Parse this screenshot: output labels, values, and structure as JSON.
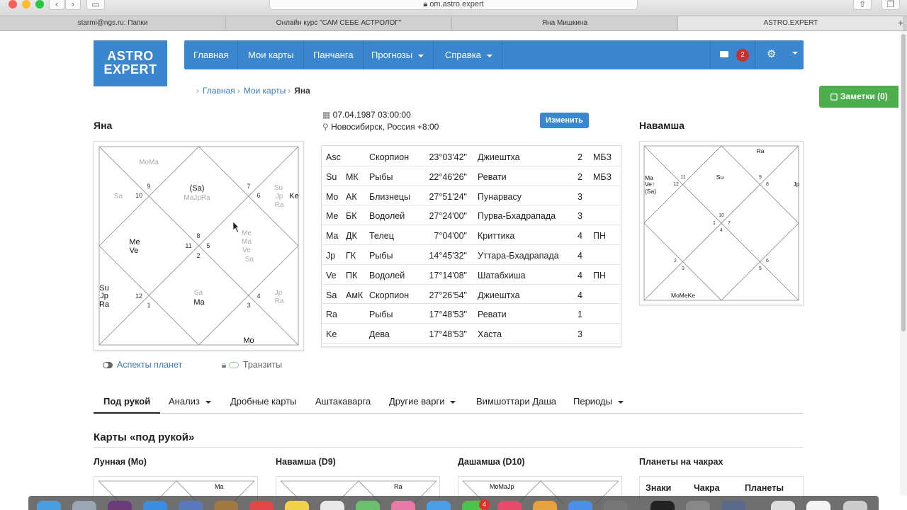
{
  "browser": {
    "url": "om.astro.expert",
    "tabs": [
      "starmi@ngs.ru: Папки",
      "Онлайн курс \"САМ СЕБЕ АСТРОЛОГ\"",
      "Яна Мишкина",
      "ASTRO.EXPERT"
    ],
    "new_tab": "+",
    "back": "‹",
    "forward": "›"
  },
  "logo": {
    "line1": "ASTRO",
    "line2": "EXPERT"
  },
  "nav": {
    "items": [
      "Главная",
      "Мои карты",
      "Панчанга",
      "Прогнозы",
      "Справка"
    ],
    "mail_count": "2"
  },
  "breadcrumb": {
    "home": "Главная",
    "cards": "Мои карты",
    "current": "Яна"
  },
  "notes_button": "Заметки (0)",
  "person": {
    "name": "Яна",
    "datetime": "07.04.1987 03:00:00",
    "place": "Новосибирск, Россия +8:00",
    "edit": "Изменить"
  },
  "navamsha_title": "Навамша",
  "planets": [
    {
      "p": "Asc",
      "k": "",
      "sign": "Скорпион",
      "deg": "23°03'42\"",
      "nak": "Джиештха",
      "pada": "2",
      "st": "МБЗ"
    },
    {
      "p": "Su",
      "k": "МК",
      "sign": "Рыбы",
      "deg": "22°46'26\"",
      "nak": "Ревати",
      "pada": "2",
      "st": "МБЗ"
    },
    {
      "p": "Mo",
      "k": "АК",
      "sign": "Близнецы",
      "deg": "27°51'24\"",
      "nak": "Пунарвасу",
      "pada": "3",
      "st": ""
    },
    {
      "p": "Me",
      "k": "БК",
      "sign": "Водолей",
      "deg": "27°24'00\"",
      "nak": "Пурва-Бхадрапада",
      "pada": "3",
      "st": ""
    },
    {
      "p": "Ma",
      "k": "ДК",
      "sign": "Телец",
      "deg": "7°04'00\"",
      "nak": "Криттика",
      "pada": "4",
      "st": "ПН"
    },
    {
      "p": "Jp",
      "k": "ГК",
      "sign": "Рыбы",
      "deg": "14°45'32\"",
      "nak": "Уттара-Бхадрапада",
      "pada": "4",
      "st": ""
    },
    {
      "p": "Ve",
      "k": "ПК",
      "sign": "Водолей",
      "deg": "17°14'08\"",
      "nak": "Шатабхиша",
      "pada": "4",
      "st": "ПН"
    },
    {
      "p": "Sa",
      "k": "АмК",
      "sign": "Скорпион",
      "deg": "27°26'54\"",
      "nak": "Джиештха",
      "pada": "4",
      "st": ""
    },
    {
      "p": "Ra",
      "k": "",
      "sign": "Рыбы",
      "deg": "17°48'53\"",
      "nak": "Ревати",
      "pada": "1",
      "st": ""
    },
    {
      "p": "Ke",
      "k": "",
      "sign": "Дева",
      "deg": "17°48'53\"",
      "nak": "Хаста",
      "pada": "3",
      "st": ""
    }
  ],
  "toggles": {
    "aspects": "Аспекты планет",
    "transits": "Транзиты"
  },
  "subtabs": [
    "Под рукой",
    "Анализ",
    "Дробные карты",
    "Аштакаварга",
    "Другие варги",
    "Вимшоттари Даша",
    "Периоды"
  ],
  "hand": {
    "title": "Карты «под рукой»",
    "lunar": "Лунная (Mo)",
    "navamsha": "Навамша (D9)",
    "dashamsha": "Дашамша (D10)",
    "chakras": "Планеты на чакрах",
    "chakra_cols": [
      "Знаки",
      "Чакра",
      "Планеты"
    ],
    "mini1": "Ma",
    "mini2": "Ra",
    "mini3": "MoMaJp"
  },
  "colors": {
    "brand": "#3a86cf",
    "notes": "#4cae4c",
    "badge": "#c9302c",
    "link": "#3a7cc0"
  }
}
